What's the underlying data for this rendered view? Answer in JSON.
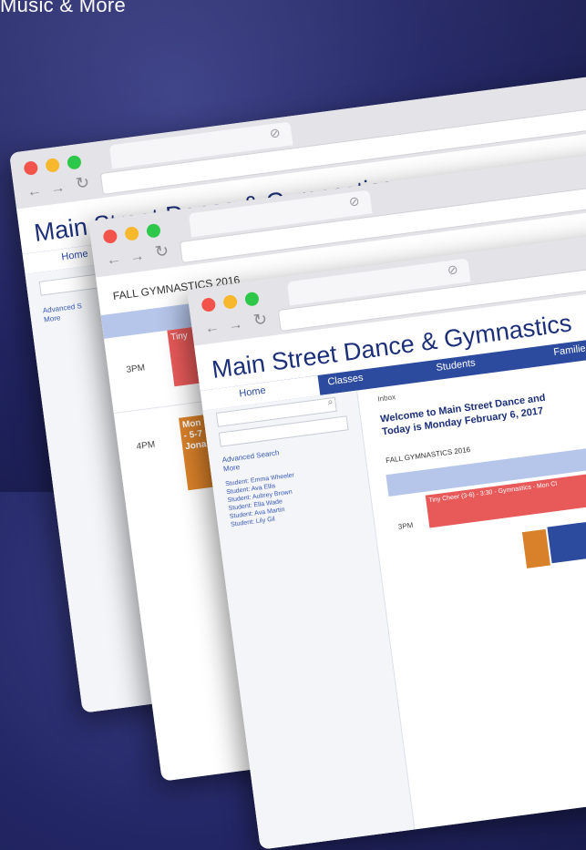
{
  "caption": "Music & More",
  "windows": [
    {
      "site_title": "Main Street Dance & Gymnastics",
      "nav": [
        "Home"
      ],
      "sidebar": [
        "Advanced S",
        "More"
      ]
    },
    {
      "schedule_title": "FALL GYMNASTICS 2016",
      "times": [
        "3PM",
        "4PM"
      ],
      "classes": [
        {
          "label": "Tiny"
        },
        {
          "label": "Mon",
          "line2": "- 5-7",
          "line3": "Jona"
        }
      ]
    },
    {
      "site_title": "Main Street Dance & Gymnastics",
      "nav": {
        "home": "Home",
        "classes": "Classes",
        "students": "Students",
        "families": "Families"
      },
      "sidebar": {
        "advanced_search": "Advanced Search",
        "more": "More",
        "students": [
          "Student: Emma Wheeler",
          "Student: Ava Ellis",
          "Student: Aubrey Brown",
          "Student: Ella Wade",
          "Student: Ava Martin",
          "Student: Lily Gil"
        ]
      },
      "main": {
        "crumb": "Inbox",
        "welcome_line1": "Welcome to Main Street Dance and",
        "welcome_line2": "Today is Monday February 6, 2017",
        "schedule_title": "FALL GYMNASTICS 2016",
        "time": "3PM",
        "class_label": "Tiny Cheer (3-6) - 3:30 - Gymnastics - Mon Cl"
      }
    }
  ],
  "colors": {
    "nav_blue": "#2c4a9e",
    "red_class": "#e85a5a",
    "orange_class": "#d9812a"
  }
}
